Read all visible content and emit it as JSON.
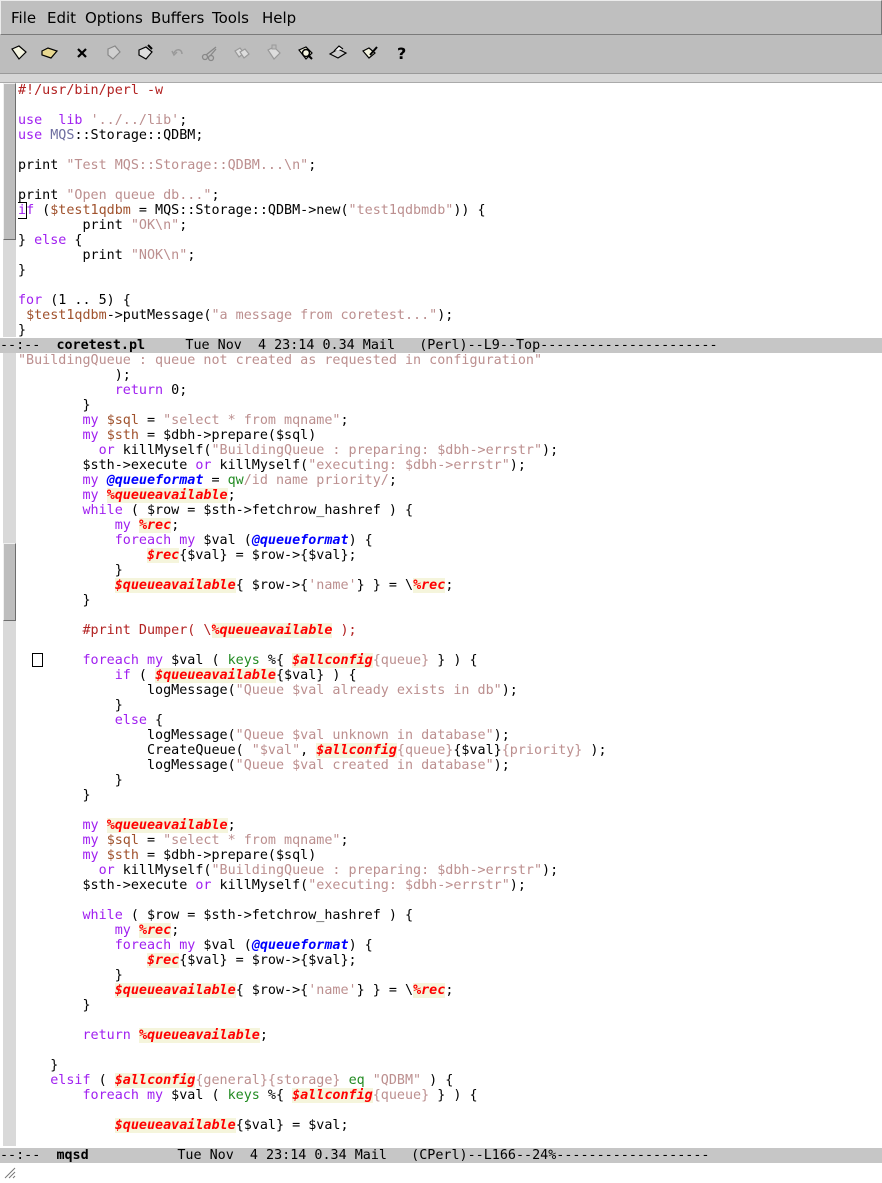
{
  "menubar": {
    "items": [
      "File",
      "Edit",
      "Options",
      "Buffers",
      "Tools",
      "Help"
    ]
  },
  "toolbar": {
    "icons": [
      "new-file-icon",
      "open-folder-icon",
      "close-x-icon",
      "save-disk-icon",
      "save-as-icon",
      "undo-icon",
      "cut-scissors-icon",
      "copy-icon",
      "paste-icon",
      "search-icon",
      "print-icon",
      "edit-preferences-icon",
      "help-question-icon"
    ]
  },
  "top_buffer": {
    "lines": [
      [
        [
          "cm",
          "#!/usr/bin/perl -w"
        ]
      ],
      [],
      [
        [
          "k",
          "use"
        ],
        [
          "",
          "  "
        ],
        [
          "k",
          "lib"
        ],
        [
          "",
          " "
        ],
        [
          "s",
          "'../../lib'"
        ],
        [
          "",
          ";"
        ]
      ],
      [
        [
          "k",
          "use"
        ],
        [
          "",
          " "
        ],
        [
          "fn",
          "MQS"
        ],
        [
          "",
          "::Storage::QDBM;"
        ]
      ],
      [],
      [
        [
          "",
          "print "
        ],
        [
          "s",
          "\"Test MQS::Storage::QDBM...\\n\""
        ],
        [
          "",
          ";"
        ]
      ],
      [],
      [
        [
          "",
          "print "
        ],
        [
          "s",
          "\"Open queue db...\""
        ],
        [
          "",
          ";"
        ]
      ],
      [
        [
          "k",
          "if"
        ],
        [
          "",
          " ("
        ],
        [
          "v",
          "$test1qdbm"
        ],
        [
          "",
          " = MQS::Storage::QDBM->new("
        ],
        [
          "s",
          "\"test1qdbmdb\""
        ],
        [
          "",
          ")) {"
        ]
      ],
      [
        [
          "",
          "        print "
        ],
        [
          "s",
          "\"OK\\n\""
        ],
        [
          "",
          ";"
        ]
      ],
      [
        [
          "",
          "} "
        ],
        [
          "k",
          "else"
        ],
        [
          "",
          " {"
        ]
      ],
      [
        [
          "",
          "        print "
        ],
        [
          "s",
          "\"NOK\\n\""
        ],
        [
          "",
          ";"
        ]
      ],
      [
        [
          "",
          "}"
        ]
      ],
      [],
      [
        [
          "k",
          "for"
        ],
        [
          "",
          " (1 .. 5) {"
        ]
      ],
      [
        [
          "",
          "",
          " "
        ],
        [
          "v",
          "$test1qdbm"
        ],
        [
          "",
          "->putMessage("
        ],
        [
          "s",
          "\"a message from coretest...\""
        ],
        [
          "",
          ");"
        ]
      ],
      [
        [
          "",
          "}"
        ]
      ]
    ]
  },
  "modeline_top": {
    "prefix": "--:--  ",
    "buffer_name": "coretest.pl",
    "info": "     Tue Nov  4 23:14 0.34 Mail   (Perl)--L9--Top----------------------"
  },
  "bottom_buffer": {
    "lines": [
      [
        [
          "s",
          "\"BuildingQueue : queue not created as requested in configuration\""
        ]
      ],
      [
        [
          "",
          "            );"
        ]
      ],
      [
        [
          "",
          "            "
        ],
        [
          "k",
          "return"
        ],
        [
          "",
          " 0;"
        ]
      ],
      [
        [
          "",
          "        }"
        ]
      ],
      [
        [
          "",
          "        "
        ],
        [
          "k",
          "my"
        ],
        [
          "",
          " "
        ],
        [
          "v",
          "$sql"
        ],
        [
          "",
          " = "
        ],
        [
          "s",
          "\"select * from mqname\""
        ],
        [
          "",
          ";"
        ]
      ],
      [
        [
          "",
          "        "
        ],
        [
          "k",
          "my"
        ],
        [
          "",
          " "
        ],
        [
          "v",
          "$sth"
        ],
        [
          "",
          " = $dbh->prepare($sql)"
        ]
      ],
      [
        [
          "",
          "          "
        ],
        [
          "k",
          "or"
        ],
        [
          "",
          " killMyself("
        ],
        [
          "s",
          "\"BuildingQueue : preparing: $dbh->errstr\""
        ],
        [
          "",
          ");"
        ]
      ],
      [
        [
          "",
          "        $sth->execute "
        ],
        [
          "k",
          "or"
        ],
        [
          "",
          " killMyself("
        ],
        [
          "s",
          "\"executing: $dbh->errstr\""
        ],
        [
          "",
          ");"
        ]
      ],
      [
        [
          "",
          "        "
        ],
        [
          "k",
          "my"
        ],
        [
          "",
          " "
        ],
        [
          "arr",
          "@queueformat"
        ],
        [
          "",
          " = "
        ],
        [
          "bi",
          "qw"
        ],
        [
          "s",
          "/id name priority/"
        ],
        [
          "",
          ";"
        ]
      ],
      [
        [
          "",
          "        "
        ],
        [
          "k",
          "my"
        ],
        [
          "",
          " "
        ],
        [
          "hash",
          "%queueavailable"
        ],
        [
          "",
          ";"
        ]
      ],
      [
        [
          "",
          "        "
        ],
        [
          "k",
          "while"
        ],
        [
          "",
          " ( $row = $sth->fetchrow_hashref ) {"
        ]
      ],
      [
        [
          "",
          "            "
        ],
        [
          "k",
          "my"
        ],
        [
          "",
          " "
        ],
        [
          "hash",
          "%rec"
        ],
        [
          "",
          ";"
        ]
      ],
      [
        [
          "",
          "            "
        ],
        [
          "k",
          "foreach"
        ],
        [
          "",
          " "
        ],
        [
          "k",
          "my"
        ],
        [
          "",
          " $val ("
        ],
        [
          "arr",
          "@queueformat"
        ],
        [
          "",
          ") {"
        ]
      ],
      [
        [
          "",
          "                "
        ],
        [
          "hash",
          "$rec"
        ],
        [
          "",
          "{$val} = $row->{$val};"
        ]
      ],
      [
        [
          "",
          "            }"
        ]
      ],
      [
        [
          "",
          "            "
        ],
        [
          "hash",
          "$queueavailable"
        ],
        [
          "",
          "{ $row->{"
        ],
        [
          "s",
          "'name'"
        ],
        [
          "",
          "} } = \\"
        ],
        [
          "hash",
          "%rec"
        ],
        [
          "",
          ";"
        ]
      ],
      [
        [
          "",
          "        }"
        ]
      ],
      [],
      [
        [
          "",
          "        "
        ],
        [
          "cm",
          "#print Dumper( \\"
        ],
        [
          "hash",
          "%queueavailable"
        ],
        [
          "cm",
          " );"
        ]
      ],
      [],
      [
        [
          "",
          "        "
        ],
        [
          "k",
          "foreach"
        ],
        [
          "",
          " "
        ],
        [
          "k",
          "my"
        ],
        [
          "",
          " $val ( "
        ],
        [
          "bi",
          "keys"
        ],
        [
          "",
          " %{ "
        ],
        [
          "hash",
          "$allconfig"
        ],
        [
          "s",
          "{queue}"
        ],
        [
          "",
          " } ) {"
        ]
      ],
      [
        [
          "",
          "            "
        ],
        [
          "k",
          "if"
        ],
        [
          "",
          " ( "
        ],
        [
          "hash",
          "$queueavailable"
        ],
        [
          "",
          "{$val} ) {"
        ]
      ],
      [
        [
          "",
          "                logMessage("
        ],
        [
          "s",
          "\"Queue $val already exists in db\""
        ],
        [
          "",
          ");"
        ]
      ],
      [
        [
          "",
          "            }"
        ]
      ],
      [
        [
          "",
          "            "
        ],
        [
          "k",
          "else"
        ],
        [
          "",
          " {"
        ]
      ],
      [
        [
          "",
          "                logMessage("
        ],
        [
          "s",
          "\"Queue $val unknown in database\""
        ],
        [
          "",
          ");"
        ]
      ],
      [
        [
          "",
          "                CreateQueue( "
        ],
        [
          "s",
          "\"$val\""
        ],
        [
          "",
          ", "
        ],
        [
          "hash",
          "$allconfig"
        ],
        [
          "s",
          "{queue}"
        ],
        [
          "",
          "{$val}"
        ],
        [
          "s",
          "{priority}"
        ],
        [
          "",
          " );"
        ]
      ],
      [
        [
          "",
          "                logMessage("
        ],
        [
          "s",
          "\"Queue $val created in database\""
        ],
        [
          "",
          ");"
        ]
      ],
      [
        [
          "",
          "            }"
        ]
      ],
      [
        [
          "",
          "        }"
        ]
      ],
      [],
      [
        [
          "",
          "        "
        ],
        [
          "k",
          "my"
        ],
        [
          "",
          " "
        ],
        [
          "hash",
          "%queueavailable"
        ],
        [
          "",
          ";"
        ]
      ],
      [
        [
          "",
          "        "
        ],
        [
          "k",
          "my"
        ],
        [
          "",
          " "
        ],
        [
          "v",
          "$sql"
        ],
        [
          "",
          " = "
        ],
        [
          "s",
          "\"select * from mqname\""
        ],
        [
          "",
          ";"
        ]
      ],
      [
        [
          "",
          "        "
        ],
        [
          "k",
          "my"
        ],
        [
          "",
          " "
        ],
        [
          "v",
          "$sth"
        ],
        [
          "",
          " = $dbh->prepare($sql)"
        ]
      ],
      [
        [
          "",
          "          "
        ],
        [
          "k",
          "or"
        ],
        [
          "",
          " killMyself("
        ],
        [
          "s",
          "\"BuildingQueue : preparing: $dbh->errstr\""
        ],
        [
          "",
          ");"
        ]
      ],
      [
        [
          "",
          "        $sth->execute "
        ],
        [
          "k",
          "or"
        ],
        [
          "",
          " killMyself("
        ],
        [
          "s",
          "\"executing: $dbh->errstr\""
        ],
        [
          "",
          ");"
        ]
      ],
      [],
      [
        [
          "",
          "        "
        ],
        [
          "k",
          "while"
        ],
        [
          "",
          " ( $row = $sth->fetchrow_hashref ) {"
        ]
      ],
      [
        [
          "",
          "            "
        ],
        [
          "k",
          "my"
        ],
        [
          "",
          " "
        ],
        [
          "hash",
          "%rec"
        ],
        [
          "",
          ";"
        ]
      ],
      [
        [
          "",
          "            "
        ],
        [
          "k",
          "foreach"
        ],
        [
          "",
          " "
        ],
        [
          "k",
          "my"
        ],
        [
          "",
          " $val ("
        ],
        [
          "arr",
          "@queueformat"
        ],
        [
          "",
          ") {"
        ]
      ],
      [
        [
          "",
          "                "
        ],
        [
          "hash",
          "$rec"
        ],
        [
          "",
          "{$val} = $row->{$val};"
        ]
      ],
      [
        [
          "",
          "            }"
        ]
      ],
      [
        [
          "",
          "            "
        ],
        [
          "hash",
          "$queueavailable"
        ],
        [
          "",
          "{ $row->{"
        ],
        [
          "s",
          "'name'"
        ],
        [
          "",
          "} } = \\"
        ],
        [
          "hash",
          "%rec"
        ],
        [
          "",
          ";"
        ]
      ],
      [
        [
          "",
          "        }"
        ]
      ],
      [],
      [
        [
          "",
          "        "
        ],
        [
          "k",
          "return"
        ],
        [
          "",
          " "
        ],
        [
          "hash",
          "%queueavailable"
        ],
        [
          "",
          ";"
        ]
      ],
      [],
      [
        [
          "",
          "    }"
        ]
      ],
      [
        [
          "",
          "    "
        ],
        [
          "k",
          "elsif"
        ],
        [
          "",
          " ( "
        ],
        [
          "hash",
          "$allconfig"
        ],
        [
          "s",
          "{general}{storage}"
        ],
        [
          "",
          " "
        ],
        [
          "bi",
          "eq"
        ],
        [
          "",
          " "
        ],
        [
          "s",
          "\"QDBM\""
        ],
        [
          "",
          " ) {"
        ]
      ],
      [
        [
          "",
          "        "
        ],
        [
          "k",
          "foreach"
        ],
        [
          "",
          " "
        ],
        [
          "k",
          "my"
        ],
        [
          "",
          " $val ( "
        ],
        [
          "bi",
          "keys"
        ],
        [
          "",
          " %{ "
        ],
        [
          "hash",
          "$allconfig"
        ],
        [
          "s",
          "{queue}"
        ],
        [
          "",
          " } ) {"
        ]
      ],
      [],
      [
        [
          "",
          "            "
        ],
        [
          "hash",
          "$queueavailable"
        ],
        [
          "",
          "{$val} = $val;"
        ]
      ]
    ]
  },
  "modeline_bottom": {
    "prefix": "--:--  ",
    "buffer_name": "mqsd",
    "info": "           Tue Nov  4 23:14 0.34 Mail   (CPerl)--L166--24%-------------------"
  }
}
